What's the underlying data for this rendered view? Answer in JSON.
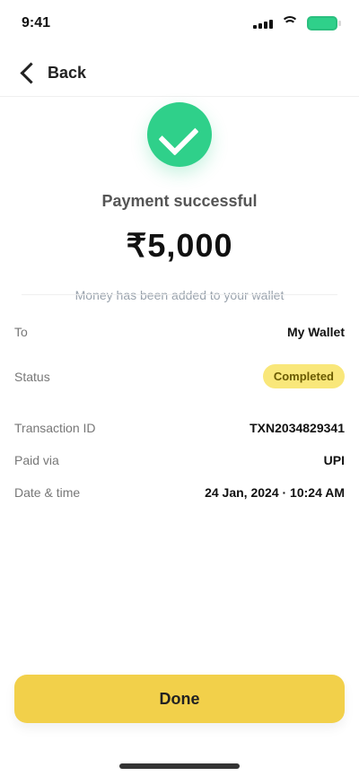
{
  "status": {
    "time": "9:41"
  },
  "header": {
    "back_label": "Back"
  },
  "success": {
    "title": "Payment successful",
    "amount": "₹5,000",
    "note": "Money has been added to your wallet",
    "icon": "check-circle-icon",
    "color": "#2fd08a"
  },
  "details": {
    "row1": {
      "label": "To",
      "value": "My Wallet"
    },
    "row2": {
      "label": "Status",
      "value": "Completed"
    },
    "row3": {
      "label": "Transaction ID",
      "value": "TXN2034829341"
    },
    "row4": {
      "label": "Paid via",
      "value": "UPI"
    },
    "row5": {
      "label": "Date & time",
      "value": "24 Jan, 2024 · 10:24 AM"
    }
  },
  "cta": {
    "label": "Done"
  },
  "colors": {
    "accent_green": "#2fd08a",
    "accent_yellow": "#f2d04a"
  }
}
